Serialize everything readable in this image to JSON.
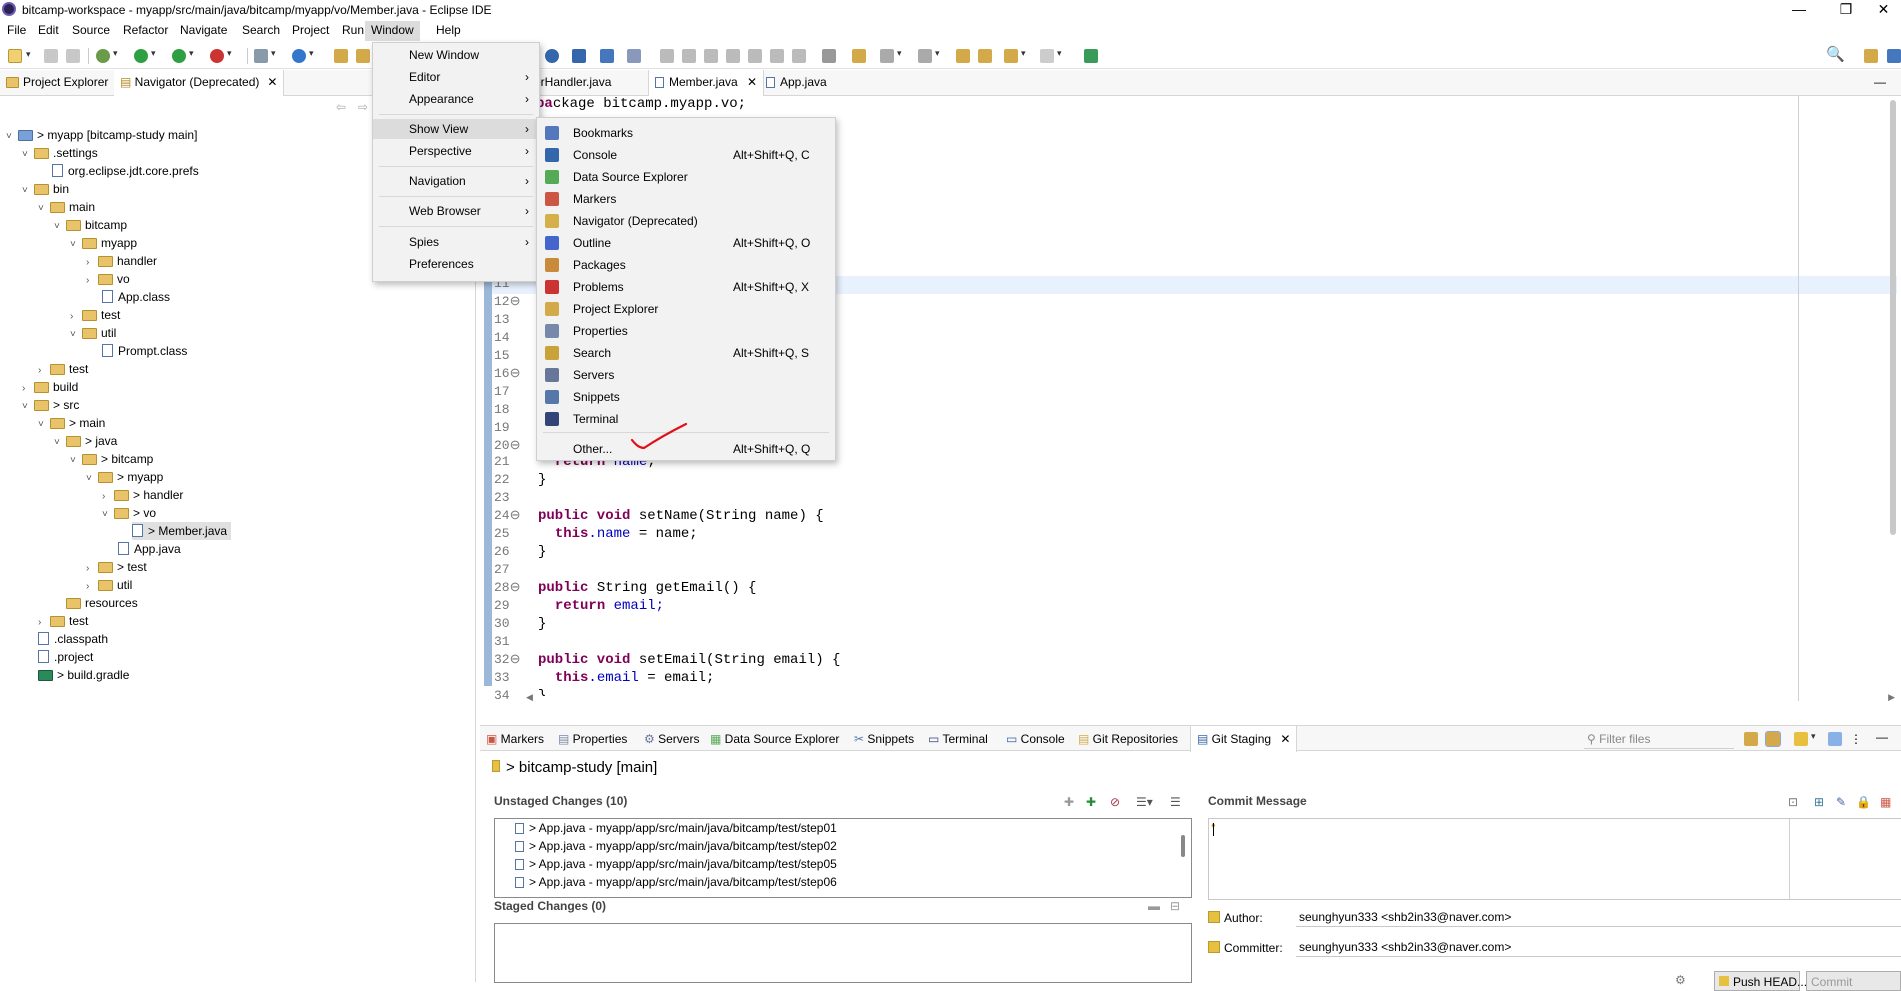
{
  "window": {
    "title": "bitcamp-workspace - myapp/src/main/java/bitcamp/myapp/vo/Member.java - Eclipse IDE",
    "controls": [
      "—",
      "❐",
      "✕"
    ]
  },
  "menubar": [
    "File",
    "Edit",
    "Source",
    "Refactor",
    "Navigate",
    "Search",
    "Project",
    "Run",
    "Window",
    "Help"
  ],
  "left_tabs": {
    "project_explorer": "Project Explorer",
    "navigator": "Navigator (Deprecated)"
  },
  "tree": [
    {
      "label": "> myapp [bitcamp-study main]"
    },
    {
      "label": ".settings"
    },
    {
      "label": "org.eclipse.jdt.core.prefs"
    },
    {
      "label": "bin"
    },
    {
      "label": "main"
    },
    {
      "label": "bitcamp"
    },
    {
      "label": "myapp"
    },
    {
      "label": "handler"
    },
    {
      "label": "vo"
    },
    {
      "label": "App.class"
    },
    {
      "label": "test"
    },
    {
      "label": "util"
    },
    {
      "label": "Prompt.class"
    },
    {
      "label": "test"
    },
    {
      "label": "build"
    },
    {
      "label": "> src"
    },
    {
      "label": "> main"
    },
    {
      "label": "> java"
    },
    {
      "label": "> bitcamp"
    },
    {
      "label": "> myapp"
    },
    {
      "label": "> handler"
    },
    {
      "label": "> vo"
    },
    {
      "label": "> Member.java"
    },
    {
      "label": "App.java"
    },
    {
      "label": "> test"
    },
    {
      "label": "util"
    },
    {
      "label": "resources"
    },
    {
      "label": "test"
    },
    {
      "label": ".classpath"
    },
    {
      "label": ".project"
    },
    {
      "label": "> build.gradle"
    }
  ],
  "editor_tabs": [
    "erHandler.java",
    "Member.java",
    "App.java"
  ],
  "code": {
    "line1": "ckage bitcamp.myapp.vo;",
    "line_numbers": [
      "11",
      "12⊖",
      "13",
      "14",
      "15",
      "16⊖",
      "17",
      "18",
      "19",
      "20⊖",
      "21",
      "22",
      "23",
      "24⊖",
      "25",
      "26",
      "27",
      "28⊖",
      "29",
      "30",
      "31",
      "32⊖",
      "33",
      "34"
    ],
    "l21": "return name;",
    "l22": "}",
    "l24a": "public void ",
    "l24b": "setName(String name) {",
    "l25a": "this",
    "l25b": ".name",
    "l25c": " = name;",
    "l26": "}",
    "l28a": "public",
    "l28b": " String getEmail() {",
    "l29a": "return ",
    "l29b": "email;",
    "l30": "}",
    "l32a": "public void ",
    "l32b": "setEmail(String email) {",
    "l33a": "this",
    "l33b": ".email",
    "l33c": " = email;",
    "l34": "}"
  },
  "window_menu": {
    "items": [
      "New Window",
      "Editor",
      "Appearance",
      "Show View",
      "Perspective",
      "Navigation",
      "Web Browser",
      "Spies",
      "Preferences"
    ]
  },
  "show_view": {
    "items": [
      {
        "label": "Bookmarks",
        "shortcut": "",
        "color": "#5577bb"
      },
      {
        "label": "Console",
        "shortcut": "Alt+Shift+Q, C",
        "color": "#3366aa"
      },
      {
        "label": "Data Source Explorer",
        "shortcut": "",
        "color": "#55aa55"
      },
      {
        "label": "Markers",
        "shortcut": "",
        "color": "#cc5544"
      },
      {
        "label": "Navigator (Deprecated)",
        "shortcut": "",
        "color": "#d4b04a"
      },
      {
        "label": "Outline",
        "shortcut": "Alt+Shift+Q, O",
        "color": "#4466cc"
      },
      {
        "label": "Packages",
        "shortcut": "",
        "color": "#c98a3a"
      },
      {
        "label": "Problems",
        "shortcut": "Alt+Shift+Q, X",
        "color": "#cc3333"
      },
      {
        "label": "Project Explorer",
        "shortcut": "",
        "color": "#d4a94a"
      },
      {
        "label": "Properties",
        "shortcut": "",
        "color": "#7788aa"
      },
      {
        "label": "Search",
        "shortcut": "Alt+Shift+Q, S",
        "color": "#c9a23a"
      },
      {
        "label": "Servers",
        "shortcut": "",
        "color": "#667799"
      },
      {
        "label": "Snippets",
        "shortcut": "",
        "color": "#5577aa"
      },
      {
        "label": "Terminal",
        "shortcut": "",
        "color": "#334477"
      },
      {
        "label": "Other...",
        "shortcut": "Alt+Shift+Q, Q",
        "color": ""
      }
    ]
  },
  "bottom_tabs": [
    "Markers",
    "Properties",
    "Servers",
    "Data Source Explorer",
    "Snippets",
    "Terminal",
    "Console",
    "Git Repositories",
    "Git Staging"
  ],
  "filter_placeholder": "Filter files",
  "git": {
    "repo": "> bitcamp-study [main]",
    "unstaged_header": "Unstaged Changes (10)",
    "staged_header": "Staged Changes (0)",
    "commit_header": "Commit Message",
    "unstaged": [
      "> App.java - myapp/app/src/main/java/bitcamp/test/step01",
      "> App.java - myapp/app/src/main/java/bitcamp/test/step02",
      "> App.java - myapp/app/src/main/java/bitcamp/test/step05",
      "> App.java - myapp/app/src/main/java/bitcamp/test/step06"
    ],
    "author_label": "Author:",
    "author": "seunghyun333 <shb2in33@naver.com>",
    "committer_label": "Committer:",
    "committer": "seunghyun333 <shb2in33@naver.com>",
    "push_btn": "Push HEAD...",
    "commit_btn": "Commit"
  }
}
